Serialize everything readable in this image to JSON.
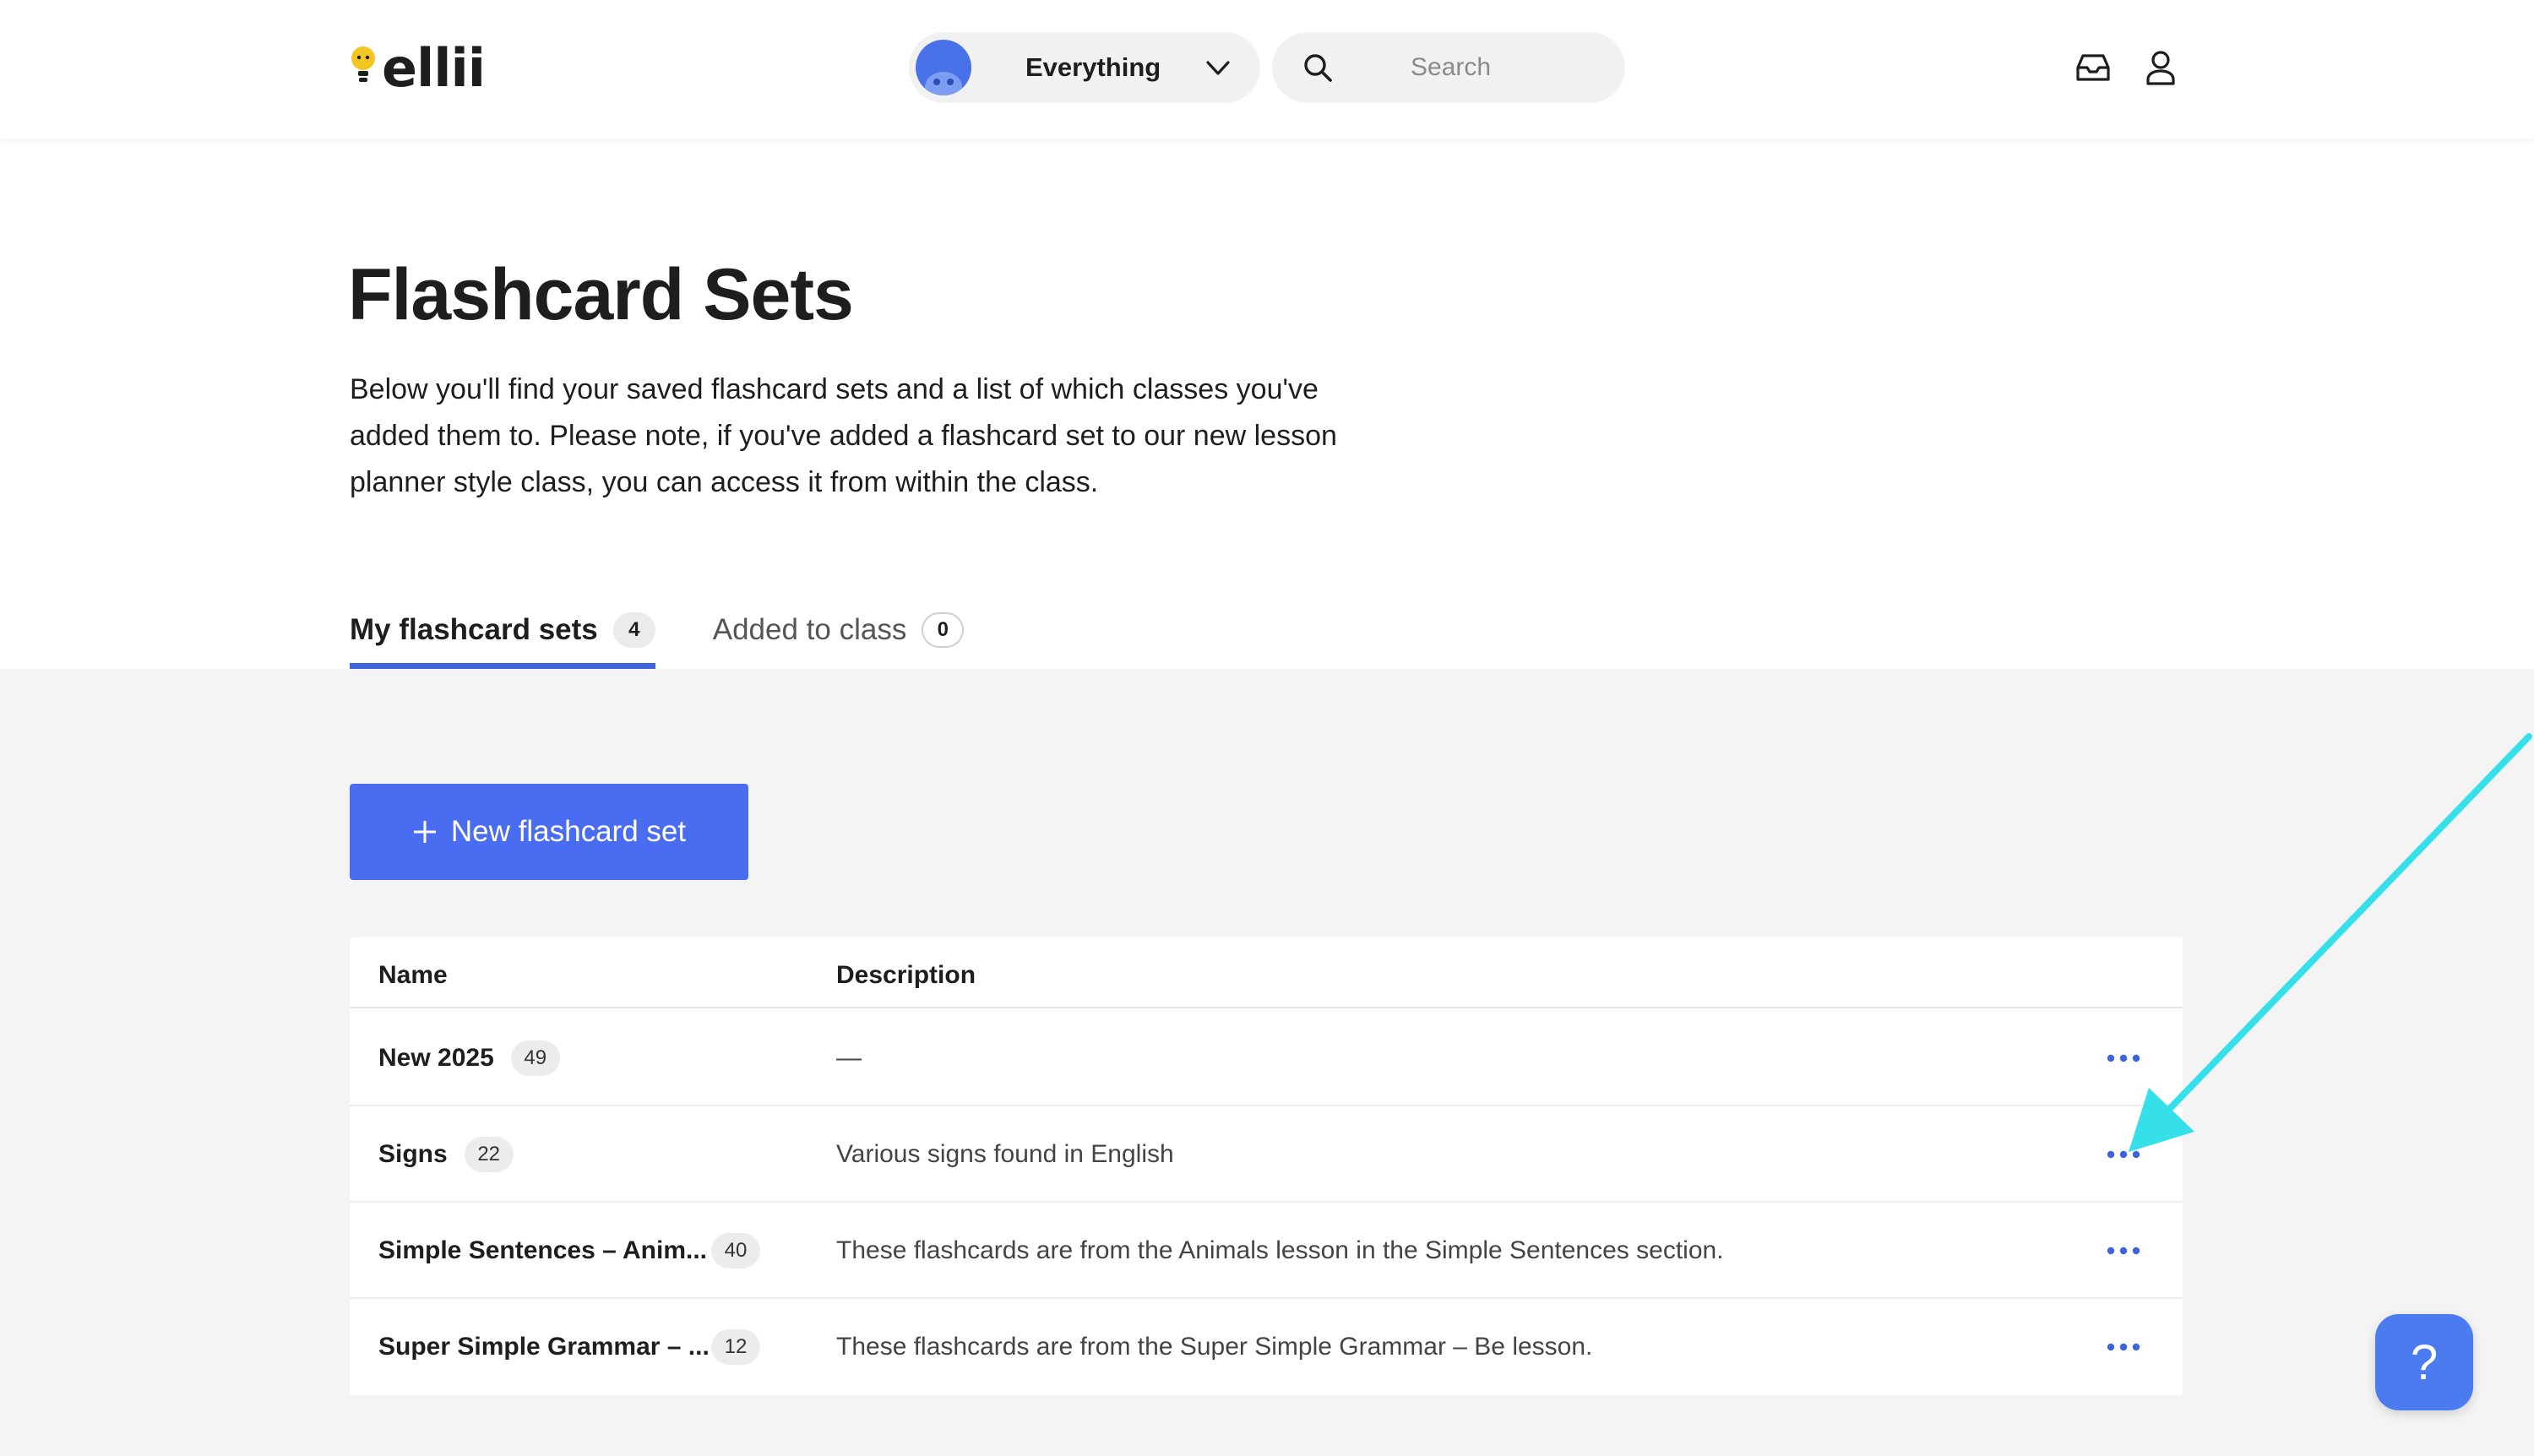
{
  "header": {
    "logo_text": "ellii",
    "scope": {
      "selected": "Everything"
    },
    "search": {
      "placeholder": "Search"
    }
  },
  "page": {
    "title": "Flashcard Sets",
    "description": "Below you'll find your saved flashcard sets and a list of which classes you've added them to. Please note, if you've added a flashcard set to our new lesson planner style class, you can access it from within the class."
  },
  "tabs": [
    {
      "label": "My flashcard sets",
      "count": "4",
      "active": true
    },
    {
      "label": "Added to class",
      "count": "0",
      "active": false
    }
  ],
  "new_button": {
    "label": "New flashcard set"
  },
  "table": {
    "columns": [
      "Name",
      "Description"
    ],
    "rows": [
      {
        "name": "New 2025",
        "count": "49",
        "description": "—"
      },
      {
        "name": "Signs",
        "count": "22",
        "description": "Various signs found in English"
      },
      {
        "name": "Simple Sentences – Anim...",
        "count": "40",
        "description": "These flashcards are from the Animals lesson in the Simple Sentences section."
      },
      {
        "name": "Super Simple Grammar – ...",
        "count": "12",
        "description": "These flashcards are from the Super Simple Grammar – Be lesson."
      }
    ]
  },
  "help": {
    "label": "?"
  },
  "colors": {
    "accent": "#4a6cf0",
    "tab_underline": "#3d63dd",
    "more_dots": "#3d63dd",
    "annotation_arrow": "#36e0ea",
    "logo_bulb": "#f3c623"
  }
}
